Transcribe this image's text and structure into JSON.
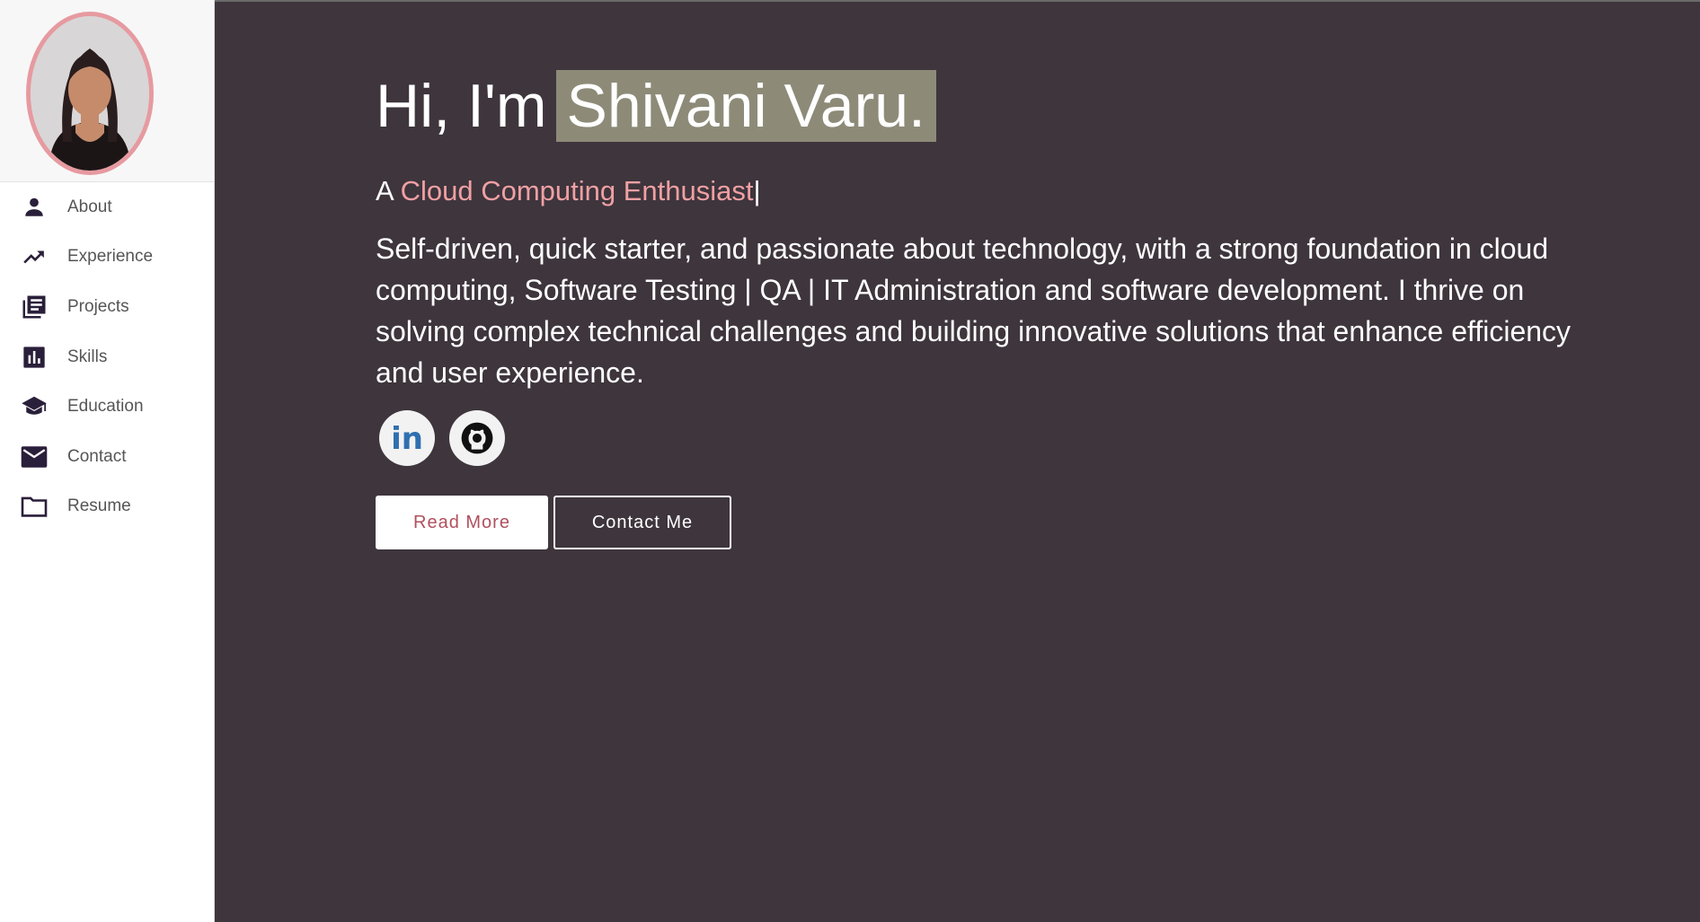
{
  "sidebar": {
    "items": [
      {
        "label": "About",
        "icon": "person-icon"
      },
      {
        "label": "Experience",
        "icon": "trending-up-icon"
      },
      {
        "label": "Projects",
        "icon": "library-books-icon"
      },
      {
        "label": "Skills",
        "icon": "bar-chart-icon"
      },
      {
        "label": "Education",
        "icon": "graduation-cap-icon"
      },
      {
        "label": "Contact",
        "icon": "mail-icon"
      },
      {
        "label": "Resume",
        "icon": "folder-icon"
      }
    ]
  },
  "hero": {
    "greeting": "Hi, I'm",
    "name": "Shivani Varu.",
    "tagline_prefix": "A ",
    "tagline_role": "Cloud Computing Enthusiast",
    "tagline_cursor": "|",
    "bio": "Self-driven, quick starter, and passionate about technology, with a strong foundation in cloud computing, Software Testing | QA | IT Administration and software development. I thrive on solving complex technical challenges and building innovative solutions that enhance efficiency and user experience.",
    "socials": [
      {
        "icon": "linkedin-icon",
        "label": "in"
      },
      {
        "icon": "github-icon"
      }
    ],
    "read_more_label": "Read More",
    "contact_label": "Contact Me"
  },
  "colors": {
    "background": "#3e353d",
    "accent": "#f0a0a3",
    "name_highlight": "#8d8b78",
    "sidebar_icon": "#2a1f3a"
  }
}
